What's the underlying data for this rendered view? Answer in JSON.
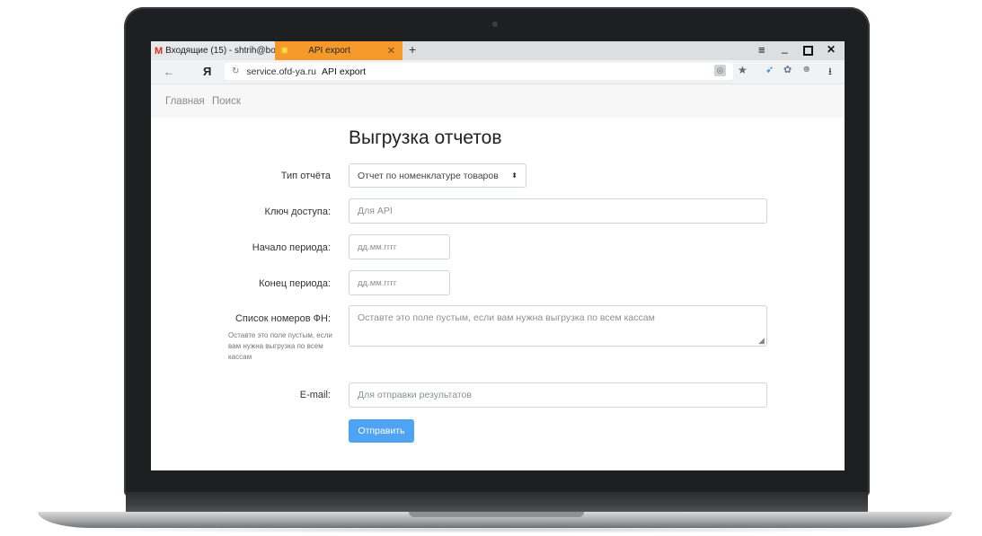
{
  "browser": {
    "tabs": [
      {
        "label": "Входящие (15) - shtrih@bo",
        "icon": "gmail-icon",
        "active": false
      },
      {
        "label": "API export",
        "icon": "api-tab-icon",
        "active": true
      }
    ],
    "new_tab_symbol": "+",
    "window_controls": {
      "menu": "≡",
      "minimize": "_",
      "close": "✕"
    },
    "address": {
      "back_symbol": "←",
      "yandex_symbol": "Я",
      "reload_symbol": "↻",
      "domain": "service.ofd-ya.ru",
      "page_title": "API export"
    },
    "toolbar_icons": [
      "shield-icon",
      "star-icon",
      "bird-icon",
      "owl-icon",
      "face-icon",
      "download-icon"
    ]
  },
  "site_nav": {
    "home": "Главная",
    "search": "Поиск"
  },
  "form": {
    "title": "Выгрузка отчетов",
    "report_type": {
      "label": "Тип отчёта",
      "selected": "Отчет по номенклатуре товаров",
      "arrow": "⬍"
    },
    "access_key": {
      "label": "Ключ доступа:",
      "placeholder": "Для API"
    },
    "period_start": {
      "label": "Начало периода:",
      "placeholder": "дд.мм.гггг"
    },
    "period_end": {
      "label": "Конец периода:",
      "placeholder": "дд.мм.гггг"
    },
    "fn_list": {
      "label": "Список номеров ФН:",
      "hint": "Оставте это поле пустым, если вам нужна выгрузка по всем кассам",
      "placeholder": "Оставте это поле пустым, если вам нужна выгрузка по всем кассам"
    },
    "email": {
      "label": "E-mail:",
      "placeholder": "Для отправки результатов"
    },
    "submit": "Отправить"
  },
  "colors": {
    "active_tab": "#f59a2a",
    "submit_button": "#4ea3f3",
    "laptop_frame": "#1e1f21"
  }
}
